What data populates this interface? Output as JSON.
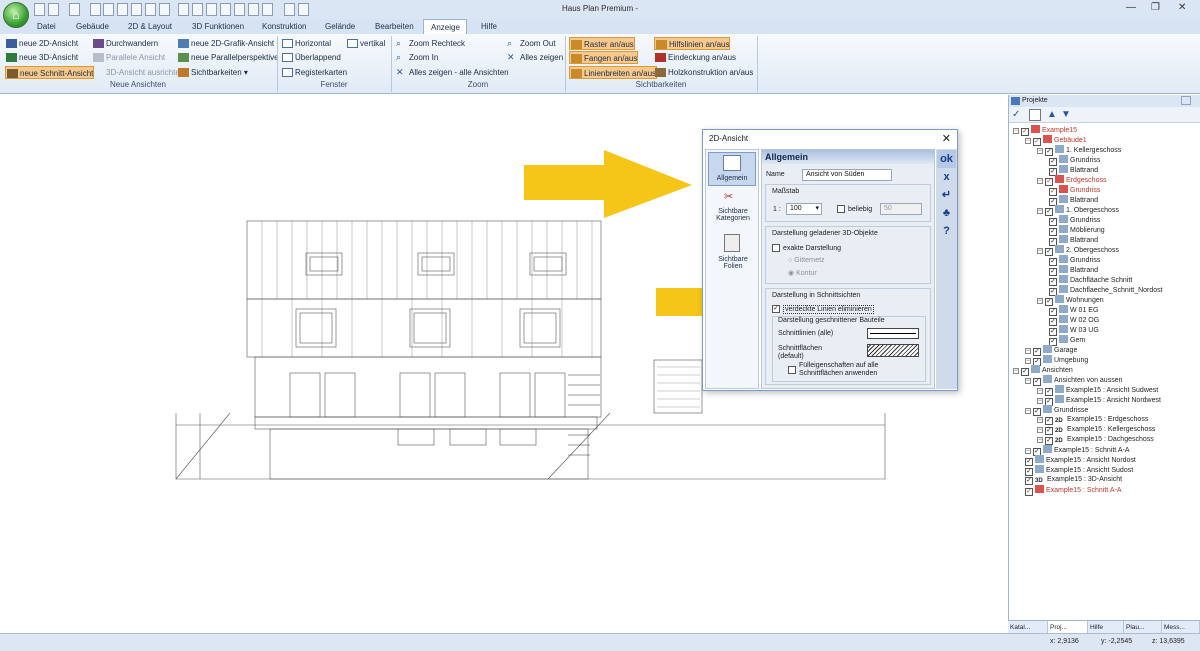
{
  "app": {
    "title": "Haus Plan Premium -"
  },
  "tabs": [
    "Datei",
    "Gebäude",
    "2D & Layout",
    "3D Funktionen",
    "Konstruktion",
    "Gelände",
    "Bearbeiten",
    "Anzeige",
    "Hilfe"
  ],
  "ribbon": {
    "neue_ansichten": {
      "label": "Neue Ansichten",
      "col1": [
        "neue 2D-Ansicht",
        "neue 3D-Ansicht",
        "neue Schnitt-Ansicht"
      ],
      "col2": [
        "Durchwandern",
        "Parallele Ansicht",
        "3D-Ansicht ausrichten"
      ],
      "col3": [
        "neue 2D-Grafik-Ansicht",
        "neue Parallelperspektive",
        "Sichtbarkeiten"
      ]
    },
    "fenster": {
      "label": "Fenster",
      "items": [
        "Horizontal",
        "vertikal",
        "Überlappend",
        "Registerkarten"
      ]
    },
    "zoom": {
      "label": "Zoom",
      "items": [
        "Zoom Rechteck",
        "Zoom Out",
        "Zoom In",
        "Alles zeigen",
        "Alles zeigen - alle Ansichten"
      ]
    },
    "sichtbarkeiten": {
      "label": "Sichtbarkeiten",
      "items": [
        "Raster an/aus",
        "Hilfslinien an/aus",
        "Fangen an/aus",
        "Eindeckung an/aus",
        "Linienbreiten an/aus",
        "Holzkonstruktion an/aus"
      ]
    }
  },
  "dialog": {
    "title": "2D-Ansicht",
    "nav": [
      "Allgemein",
      "Sichtbare Kategorien",
      "Sichtbare Folien"
    ],
    "header": "Allgemein",
    "name_label": "Name",
    "name_value": "Ansicht von Süden",
    "massstab_label": "Maßstab",
    "scale_prefix": "1 :",
    "scale_value": "100",
    "beliebig_label": "beliebig",
    "beliebig_value": "50",
    "group3d_label": "Darstellung geladener 3D-Objekte",
    "exakt_label": "exakte Darstellung",
    "gitternetz_label": "Gitternetz",
    "kontur_label": "Kontur",
    "schnitt_group_label": "Darstellung in Schnittsichten",
    "verdeckte_label": "verdeckte Linien eliminieren",
    "bauteile_label": "Darstellung geschnittener Bauteile",
    "schnittlinien_label": "Schnittlinien (alle)",
    "schnittflaechen_label": "Schnittflächen",
    "default_label": "(default)",
    "fuell_label_1": "Fülleigenschaften auf alle",
    "fuell_label_2": "Schnittflächen anwenden",
    "side_buttons": [
      "ok",
      "x",
      "↵",
      "♣",
      "?"
    ]
  },
  "panel": {
    "title": "Projekte",
    "tree": [
      {
        "t": "Example15",
        "lvl": 0,
        "red": true
      },
      {
        "t": "Gebäude1",
        "lvl": 1,
        "red": true
      },
      {
        "t": "1. Kellergeschoss",
        "lvl": 2
      },
      {
        "t": "Grundriss",
        "lvl": 3
      },
      {
        "t": "Blattrand",
        "lvl": 3
      },
      {
        "t": "Erdgeschoss",
        "lvl": 2,
        "red": true
      },
      {
        "t": "Grundriss",
        "lvl": 3,
        "red": true
      },
      {
        "t": "Blattrand",
        "lvl": 3
      },
      {
        "t": "1. Obergeschoss",
        "lvl": 2
      },
      {
        "t": "Grundriss",
        "lvl": 3
      },
      {
        "t": "Möblierung",
        "lvl": 3
      },
      {
        "t": "Blattrand",
        "lvl": 3
      },
      {
        "t": "2. Obergeschoss",
        "lvl": 2
      },
      {
        "t": "Grundriss",
        "lvl": 3
      },
      {
        "t": "Blattrand",
        "lvl": 3
      },
      {
        "t": "Dachfläache Schnitt",
        "lvl": 3
      },
      {
        "t": "Dachflaeche_Schnitt_Nordost",
        "lvl": 3
      },
      {
        "t": "Wohnungen",
        "lvl": 2
      },
      {
        "t": "W 01 EG",
        "lvl": 3
      },
      {
        "t": "W 02 OG",
        "lvl": 3
      },
      {
        "t": "W 03 UG",
        "lvl": 3
      },
      {
        "t": "Gem",
        "lvl": 3
      },
      {
        "t": "Garage",
        "lvl": 1
      },
      {
        "t": "Umgebung",
        "lvl": 1
      },
      {
        "t": "Ansichten",
        "lvl": 0
      },
      {
        "t": "Ansichten von aussen",
        "lvl": 1
      },
      {
        "t": "Example15 : Ansicht Sudwest",
        "lvl": 2
      },
      {
        "t": "Example15 : Ansicht Nordwest",
        "lvl": 2
      },
      {
        "t": "Grundrisse",
        "lvl": 1
      },
      {
        "t": "Example15 : Erdgeschoss",
        "lvl": 2,
        "tag": "2D"
      },
      {
        "t": "Example15 : Kellergeschoss",
        "lvl": 2,
        "tag": "2D"
      },
      {
        "t": "Example15 : Dachgeschoss",
        "lvl": 2,
        "tag": "2D"
      },
      {
        "t": "Example15 : Schnitt A-A",
        "lvl": 1
      },
      {
        "t": "Example15 : Ansicht Nordost",
        "lvl": 1
      },
      {
        "t": "Example15 : Ansicht Sudost",
        "lvl": 1
      },
      {
        "t": "Example15 : 3D-Ansicht",
        "lvl": 1,
        "tag": "3D"
      },
      {
        "t": "Example15 : Schnitt A-A",
        "lvl": 1,
        "red": true
      }
    ],
    "tabs": [
      "Katal...",
      "Proj...",
      "Hilfe",
      "Plau...",
      "Mess..."
    ]
  },
  "status": {
    "x": "x: 2,9136",
    "y": "y: -2,2545",
    "z": "z: 13,6395"
  },
  "colors": {
    "arrow": "#f5c518",
    "accent": "#f8c98a"
  }
}
